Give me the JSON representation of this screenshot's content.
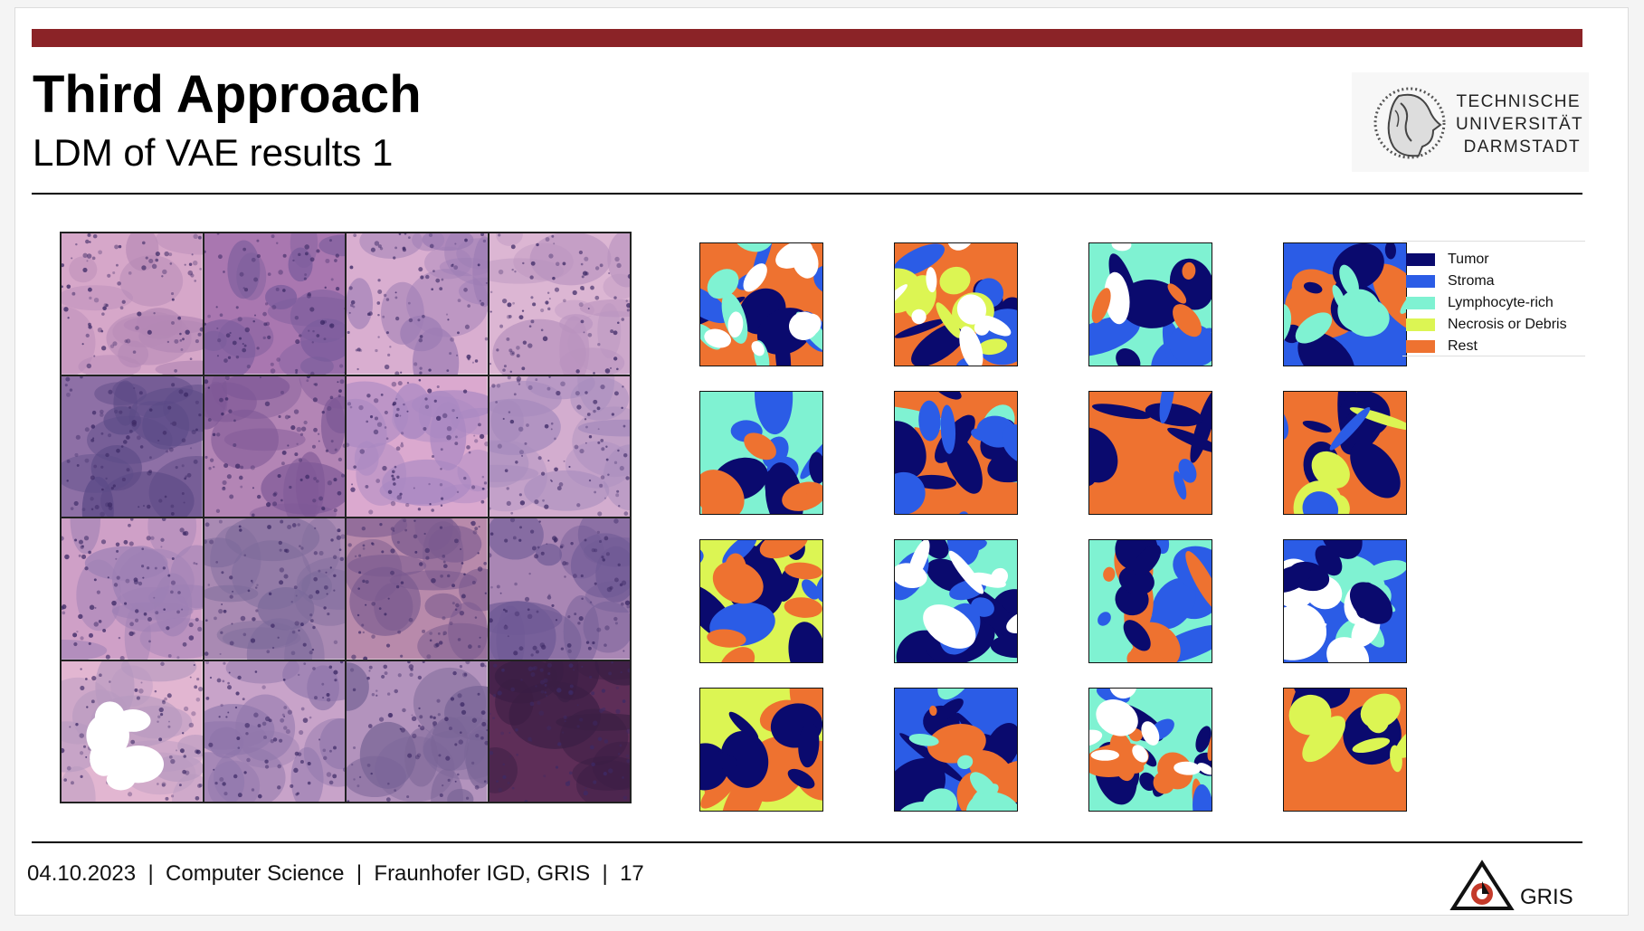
{
  "slide": {
    "title": "Third Approach",
    "subtitle": "LDM of VAE results 1",
    "university_logo_lines": [
      "TECHNISCHE",
      "UNIVERSITÄT",
      "DARMSTADT"
    ],
    "footer": {
      "date": "04.10.2023",
      "department": "Computer Science",
      "institute": "Fraunhofer IGD, GRIS",
      "page_number": "17",
      "separator": "|"
    },
    "gris_label": "GRIS"
  },
  "legend": [
    {
      "label": "Tumor",
      "color": "#0a0a6e"
    },
    {
      "label": "Stroma",
      "color": "#2b5ce6"
    },
    {
      "label": "Lymphocyte-rich",
      "color": "#7ff2d2"
    },
    {
      "label": "Necrosis or Debris",
      "color": "#dcf553"
    },
    {
      "label": "Rest",
      "color": "#ee7230"
    }
  ],
  "colors": {
    "accent_bar": "#8b2327",
    "tumor": "#0a0a6e",
    "stroma": "#2b5ce6",
    "lymphocyte": "#7ff2d2",
    "necrosis": "#dcf553",
    "rest": "#ee7230"
  },
  "icons": {
    "university": "athena-head-logo",
    "gris": "gris-triangle-logo"
  }
}
